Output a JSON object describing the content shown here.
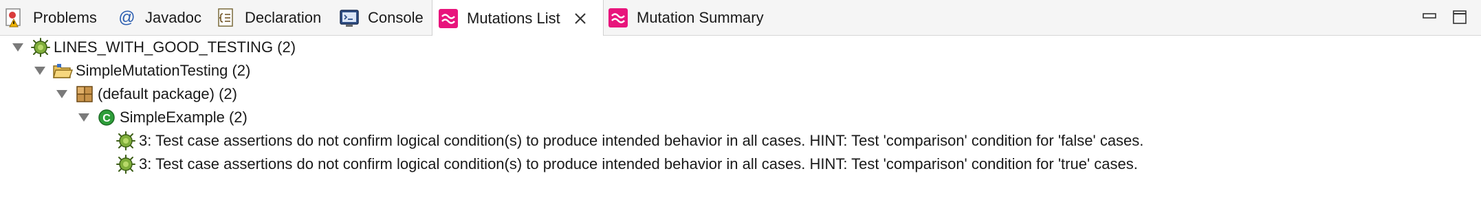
{
  "tabs": [
    {
      "label": "Problems",
      "icon": "problems-icon"
    },
    {
      "label": "Javadoc",
      "icon": "at-icon",
      "glyph": "@"
    },
    {
      "label": "Declaration",
      "icon": "declaration-icon"
    },
    {
      "label": "Console",
      "icon": "console-icon"
    },
    {
      "label": "Mutations List",
      "icon": "mutation-wave-icon",
      "active": true,
      "close_glyph": "✕"
    },
    {
      "label": "Mutation Summary",
      "icon": "mutation-wave-icon"
    }
  ],
  "window_controls": {
    "minimize_icon": "minimize-icon",
    "maximize_icon": "maximize-icon"
  },
  "tree": {
    "root": {
      "label": "LINES_WITH_GOOD_TESTING (2)",
      "icon": "bug-icon"
    },
    "project": {
      "label": "SimpleMutationTesting (2)",
      "icon": "folder-open-icon"
    },
    "package": {
      "label": "(default package) (2)",
      "icon": "package-icon"
    },
    "class": {
      "label": "SimpleExample (2)",
      "icon": "class-icon",
      "glyph": "C"
    },
    "mutations": [
      {
        "label": "3: Test case assertions do not confirm logical condition(s) to produce intended behavior in all cases. HINT: Test 'comparison' condition for 'false' cases.",
        "icon": "bug-icon"
      },
      {
        "label": "3: Test case assertions do not confirm logical condition(s) to produce intended behavior in all cases. HINT: Test 'comparison' condition for 'true' cases.",
        "icon": "bug-icon"
      }
    ]
  },
  "colors": {
    "mutation_pink": "#e8157c",
    "class_green": "#2e9e3a",
    "javadoc_blue": "#2a5db0"
  }
}
